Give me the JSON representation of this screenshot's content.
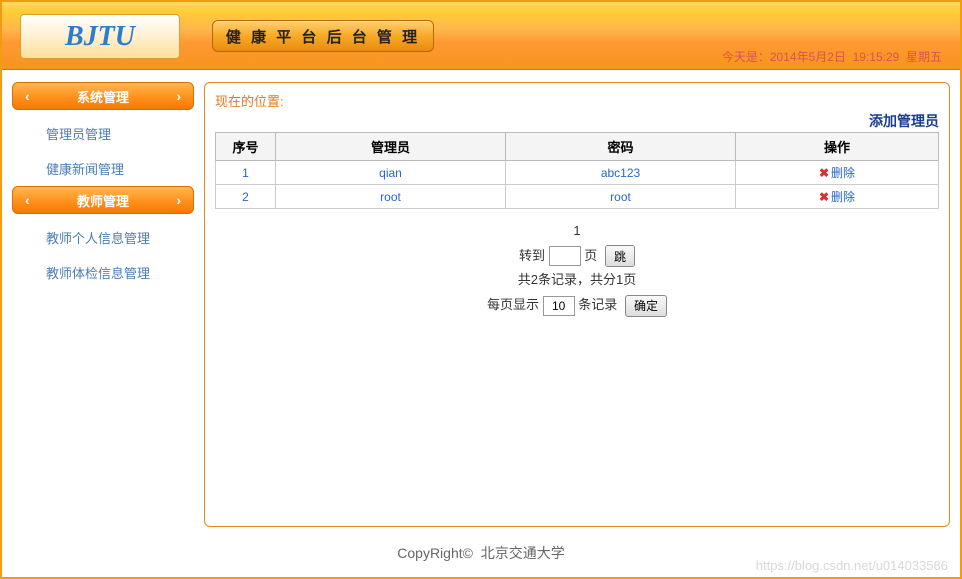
{
  "header": {
    "logo": "BJTU",
    "title": "健 康 平 台 后 台 管 理",
    "date_prefix": "今天是：",
    "date_date": "2014年5月2日",
    "date_time": "19:15:29",
    "date_weekday": "星期五"
  },
  "sidebar": {
    "groups": [
      {
        "label": "系统管理",
        "items": [
          "管理员管理",
          "健康新闻管理"
        ]
      },
      {
        "label": "教师管理",
        "items": [
          "教师个人信息管理",
          "教师体检信息管理"
        ]
      }
    ]
  },
  "content": {
    "breadcrumb": "现在的位置:",
    "add_link": "添加管理员",
    "columns": [
      "序号",
      "管理员",
      "密码",
      "操作"
    ],
    "rows": [
      {
        "seq": "1",
        "admin": "qian",
        "pwd": "abc123",
        "action": "删除"
      },
      {
        "seq": "2",
        "admin": "root",
        "pwd": "root",
        "action": "删除"
      }
    ],
    "pager": {
      "current_page": "1",
      "jump_prefix": "转到",
      "jump_suffix": "页",
      "jump_btn": "跳",
      "summary": "共2条记录，共分1页",
      "per_page_prefix": "每页显示",
      "per_page_value": "10",
      "per_page_suffix": "条记录",
      "confirm_btn": "确定"
    }
  },
  "footer": {
    "copy": "CopyRight©",
    "uni": "北京交通大学"
  },
  "watermark": "https://blog.csdn.net/u014033586"
}
